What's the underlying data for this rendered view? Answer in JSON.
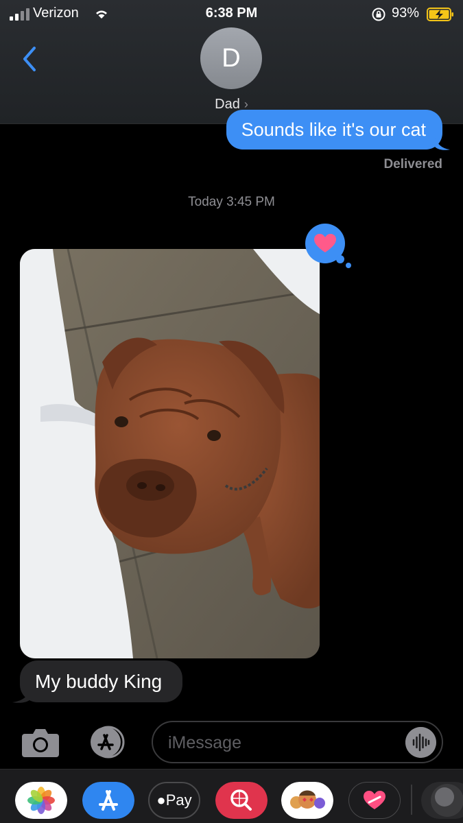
{
  "status_bar": {
    "carrier": "Verizon",
    "time": "6:38 PM",
    "battery": "93%"
  },
  "header": {
    "avatar_initial": "D",
    "contact_name": "Dad"
  },
  "messages": {
    "sent_text": "Sounds like it's our cat",
    "delivered": "Delivered",
    "timestamp_prefix": "Today",
    "timestamp_time": "3:45 PM",
    "received_text": "My buddy King",
    "tapback": "heart"
  },
  "input": {
    "placeholder": "iMessage"
  },
  "app_drawer": {
    "apple_pay_label": "Pay",
    "items": [
      "photos-app",
      "app-store",
      "apple-pay",
      "search-images",
      "memoji",
      "digital-touch",
      "more-apps"
    ]
  },
  "colors": {
    "sent_bubble": "#3d8ff5",
    "received_bubble": "#262628",
    "heart": "#ff5a8a"
  }
}
